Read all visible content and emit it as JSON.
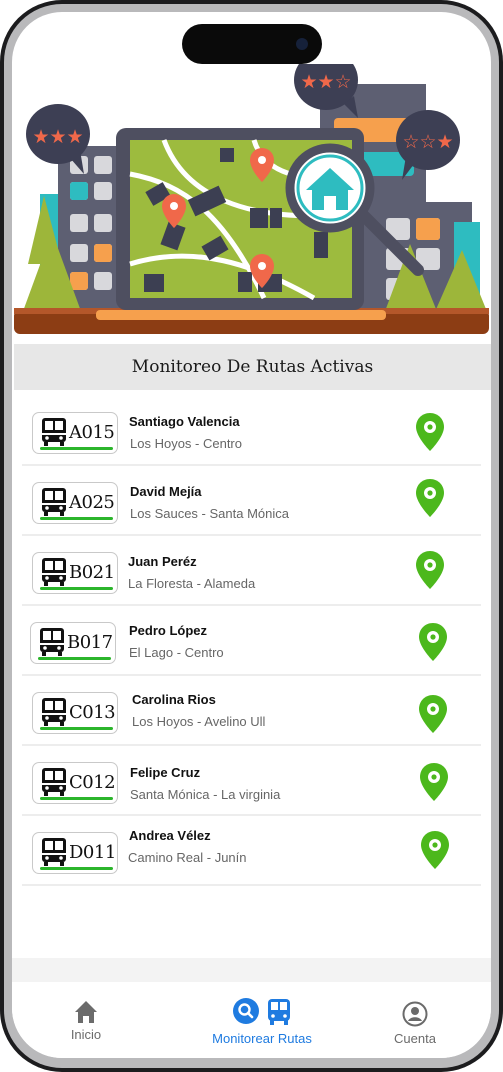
{
  "header": {
    "title": "Monitoreo De Rutas Activas"
  },
  "routes": [
    {
      "code": "A015",
      "driver": "Santiago Valencia",
      "path": "Los Hoyos - Centro"
    },
    {
      "code": "A025",
      "driver": "David Mejía",
      "path": "Los Sauces - Santa Mónica"
    },
    {
      "code": "B021",
      "driver": "Juan Peréz",
      "path": "La Floresta - Alameda"
    },
    {
      "code": "B017",
      "driver": "Pedro López",
      "path": "El Lago - Centro"
    },
    {
      "code": "C013",
      "driver": "Carolina Rios",
      "path": "Los Hoyos - Avelino Ull"
    },
    {
      "code": "C012",
      "driver": "Felipe Cruz",
      "path": "Santa Mónica - La virginia"
    },
    {
      "code": "D011",
      "driver": "Andrea Vélez",
      "path": "Camino Real - Junín"
    }
  ],
  "tabbar": {
    "home": "Inicio",
    "monitor": "Monitorear Rutas",
    "account": "Cuenta"
  },
  "colors": {
    "accent": "#1f7be0",
    "pin_green": "#4cb81c",
    "route_bar": "#2bb52b",
    "inactive_tab": "#6b6b6b"
  },
  "icons": {
    "route_badge": "bus-icon",
    "route_action": "location-pin-icon",
    "tab_home": "home-icon",
    "tab_monitor": [
      "search-icon",
      "bus-icon"
    ],
    "tab_account": "user-circle-icon"
  }
}
